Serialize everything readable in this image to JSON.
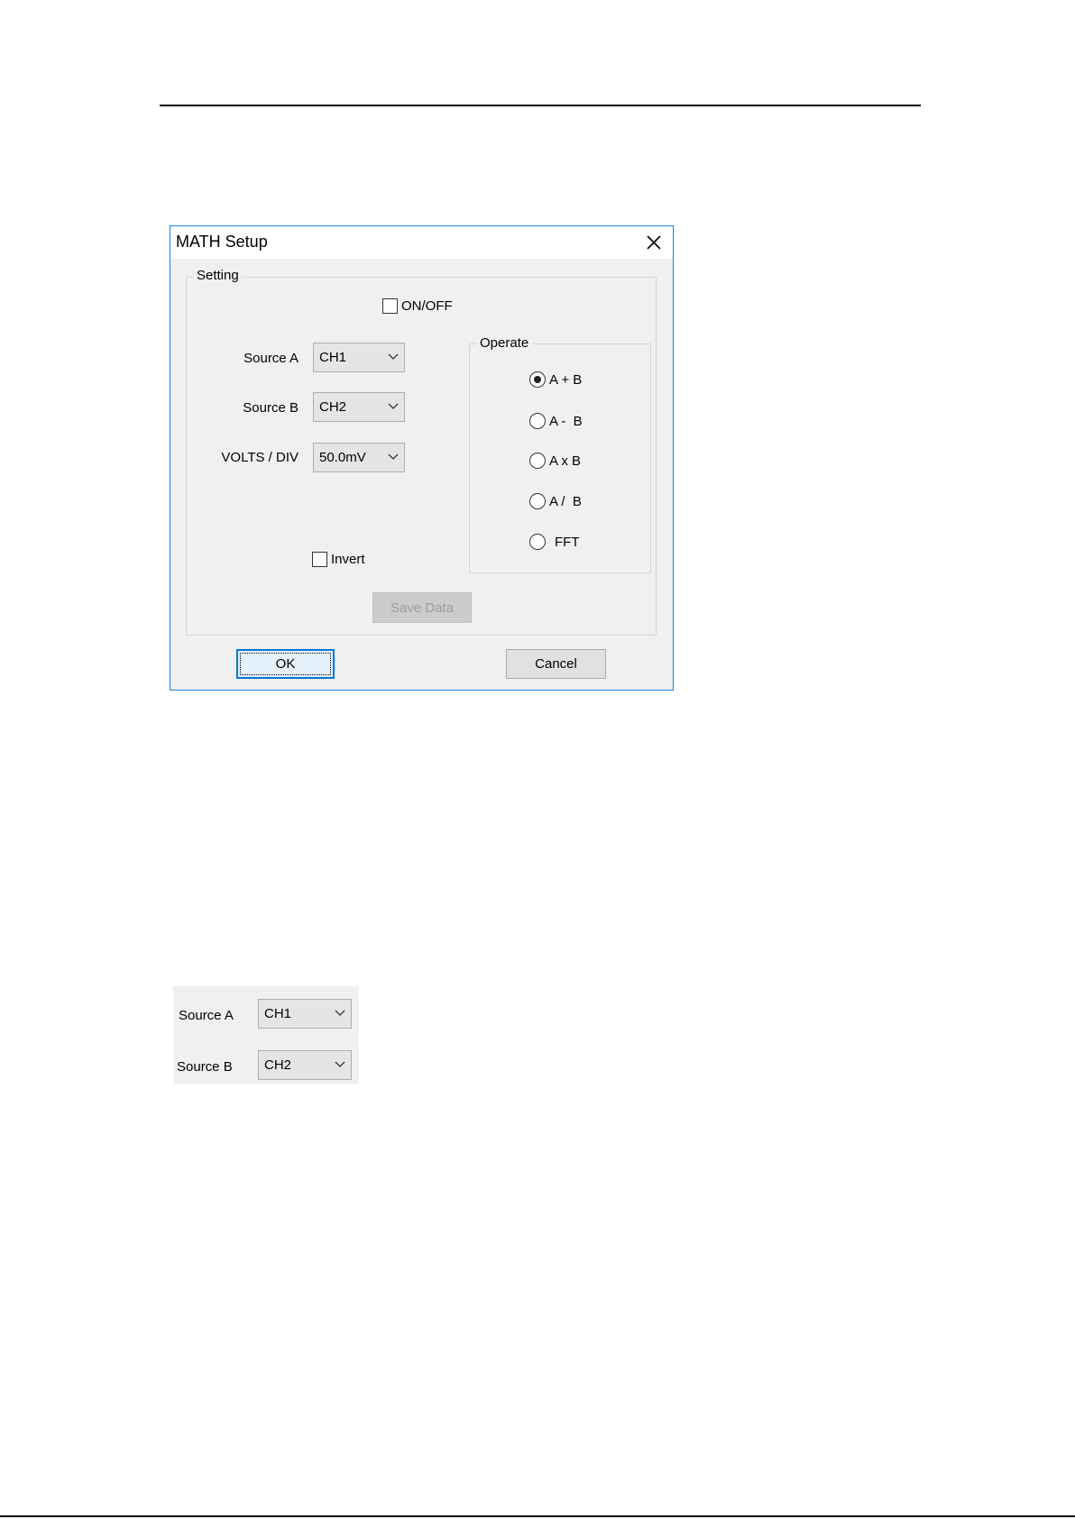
{
  "dialog": {
    "title": "MATH Setup",
    "setting_group_label": "Setting",
    "onoff_label": "ON/OFF",
    "source_a_label": "Source A",
    "source_a_value": "CH1",
    "source_b_label": "Source B",
    "source_b_value": "CH2",
    "volts_div_label": "VOLTS / DIV",
    "volts_div_value": "50.0mV",
    "operate_group_label": "Operate",
    "operations": [
      {
        "label": "A + B",
        "checked": true
      },
      {
        "label": "A -  B",
        "checked": false
      },
      {
        "label": "A x B",
        "checked": false
      },
      {
        "label": "A /  B",
        "checked": false
      },
      {
        "label": "FFT",
        "checked": false
      }
    ],
    "invert_label": "Invert",
    "save_data_label": "Save Data",
    "ok_label": "OK",
    "cancel_label": "Cancel"
  },
  "zoom": {
    "source_a_label": "Source A",
    "source_a_value": "CH1",
    "source_b_label": "Source B",
    "source_b_value": "CH2"
  },
  "colors": {
    "accent": "#0078d7",
    "dialog_border": "#1883d7",
    "dialog_bg": "#f0f0f0"
  }
}
